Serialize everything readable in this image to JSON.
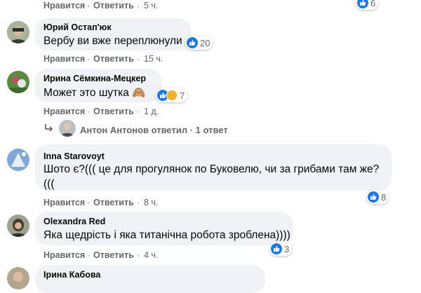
{
  "colors": {
    "like_blue": "#1877f2",
    "bubble_bg": "#f0f2f5",
    "meta_gray": "#65676b"
  },
  "top_row": {
    "like": "Нравится",
    "reply": "Ответить",
    "time": "5 ч.",
    "reactions": "6"
  },
  "comments": [
    {
      "author": "Юрий Остап'юк",
      "text": "Вербу ви вже переплюнули",
      "reactions": "20",
      "like": "Нравится",
      "reply": "Ответить",
      "time": "15 ч."
    },
    {
      "author": "Ирина Сёмкина-Мецкер",
      "text": "Может это шутка 🙈",
      "reactions": "7",
      "like": "Нравится",
      "reply": "Ответить",
      "time": "1 д."
    },
    {
      "author": "Inna Starovoyt",
      "text_line1": "Шото є?((( це для прогулянок по Буковелю, чи за грибами там же?",
      "text_line2": "(((",
      "reactions": "8",
      "like": "Нравится",
      "reply": "Ответить",
      "time": "8 ч."
    },
    {
      "author": "Olexandra Red",
      "text": "Яка щедрість і яка титанічна робота зроблена))))",
      "reactions": "3",
      "like": "Нравится",
      "reply": "Ответить",
      "time": "4 ч."
    },
    {
      "author": "Ірина Кабова"
    }
  ],
  "reply_thread": {
    "text": "Антон Антонов ответил · 1 ответ"
  }
}
